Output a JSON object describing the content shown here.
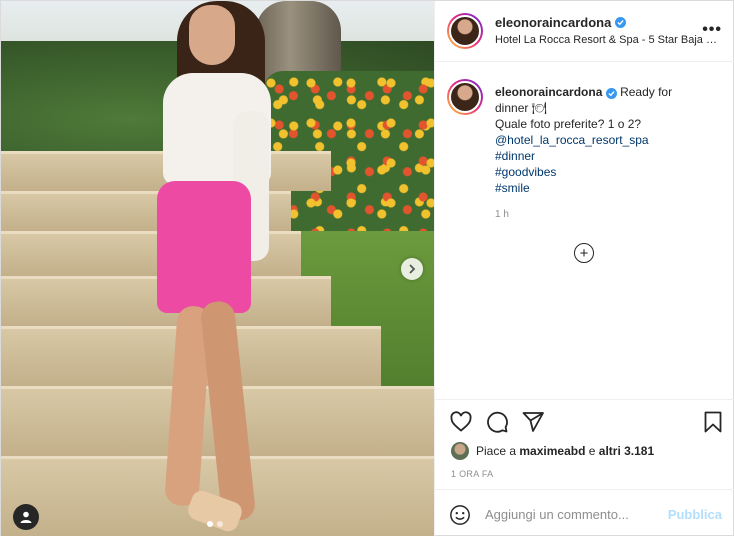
{
  "post": {
    "username": "eleonoraincardona",
    "location": "Hotel La Rocca Resort & Spa - 5 Star Baja Sardinia",
    "more_icon": "more-horizontal-icon",
    "caption": {
      "text_line1": "Ready for",
      "text_line2": "dinner 🍽",
      "line3": "Quale foto preferite? 1 o 2?",
      "mention": "@hotel_la_rocca_resort_spa",
      "hashtags": [
        "#dinner",
        "#goodvibes",
        "#smile"
      ]
    },
    "comment_time": "1 h",
    "likes_prefix": "Piace a",
    "likes_user": "maximeabd",
    "likes_conj": "e",
    "likes_others": "altri 3.181",
    "post_time": "1 ORA FA",
    "comment_placeholder": "Aggiungi un commento...",
    "publish_label": "Pubblica"
  },
  "carousel": {
    "count": 2,
    "active_index": 0
  },
  "colors": {
    "accent_link": "#00376b",
    "verified": "#3897f0",
    "publish_disabled": "#b2dffc"
  }
}
